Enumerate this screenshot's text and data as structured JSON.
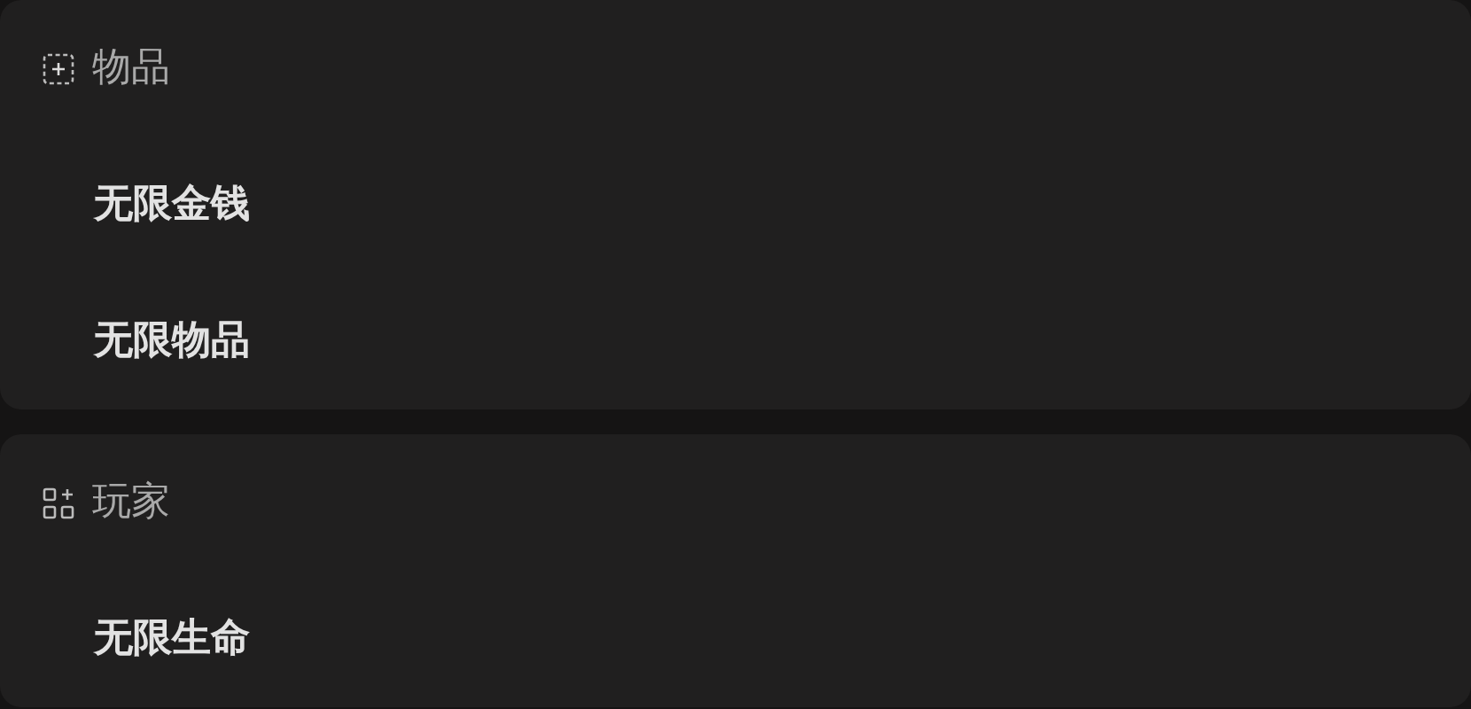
{
  "sections": [
    {
      "title": "物品",
      "items": [
        {
          "label": "无限金钱"
        },
        {
          "label": "无限物品"
        }
      ]
    },
    {
      "title": "玩家",
      "items": [
        {
          "label": "无限生命"
        }
      ]
    }
  ]
}
